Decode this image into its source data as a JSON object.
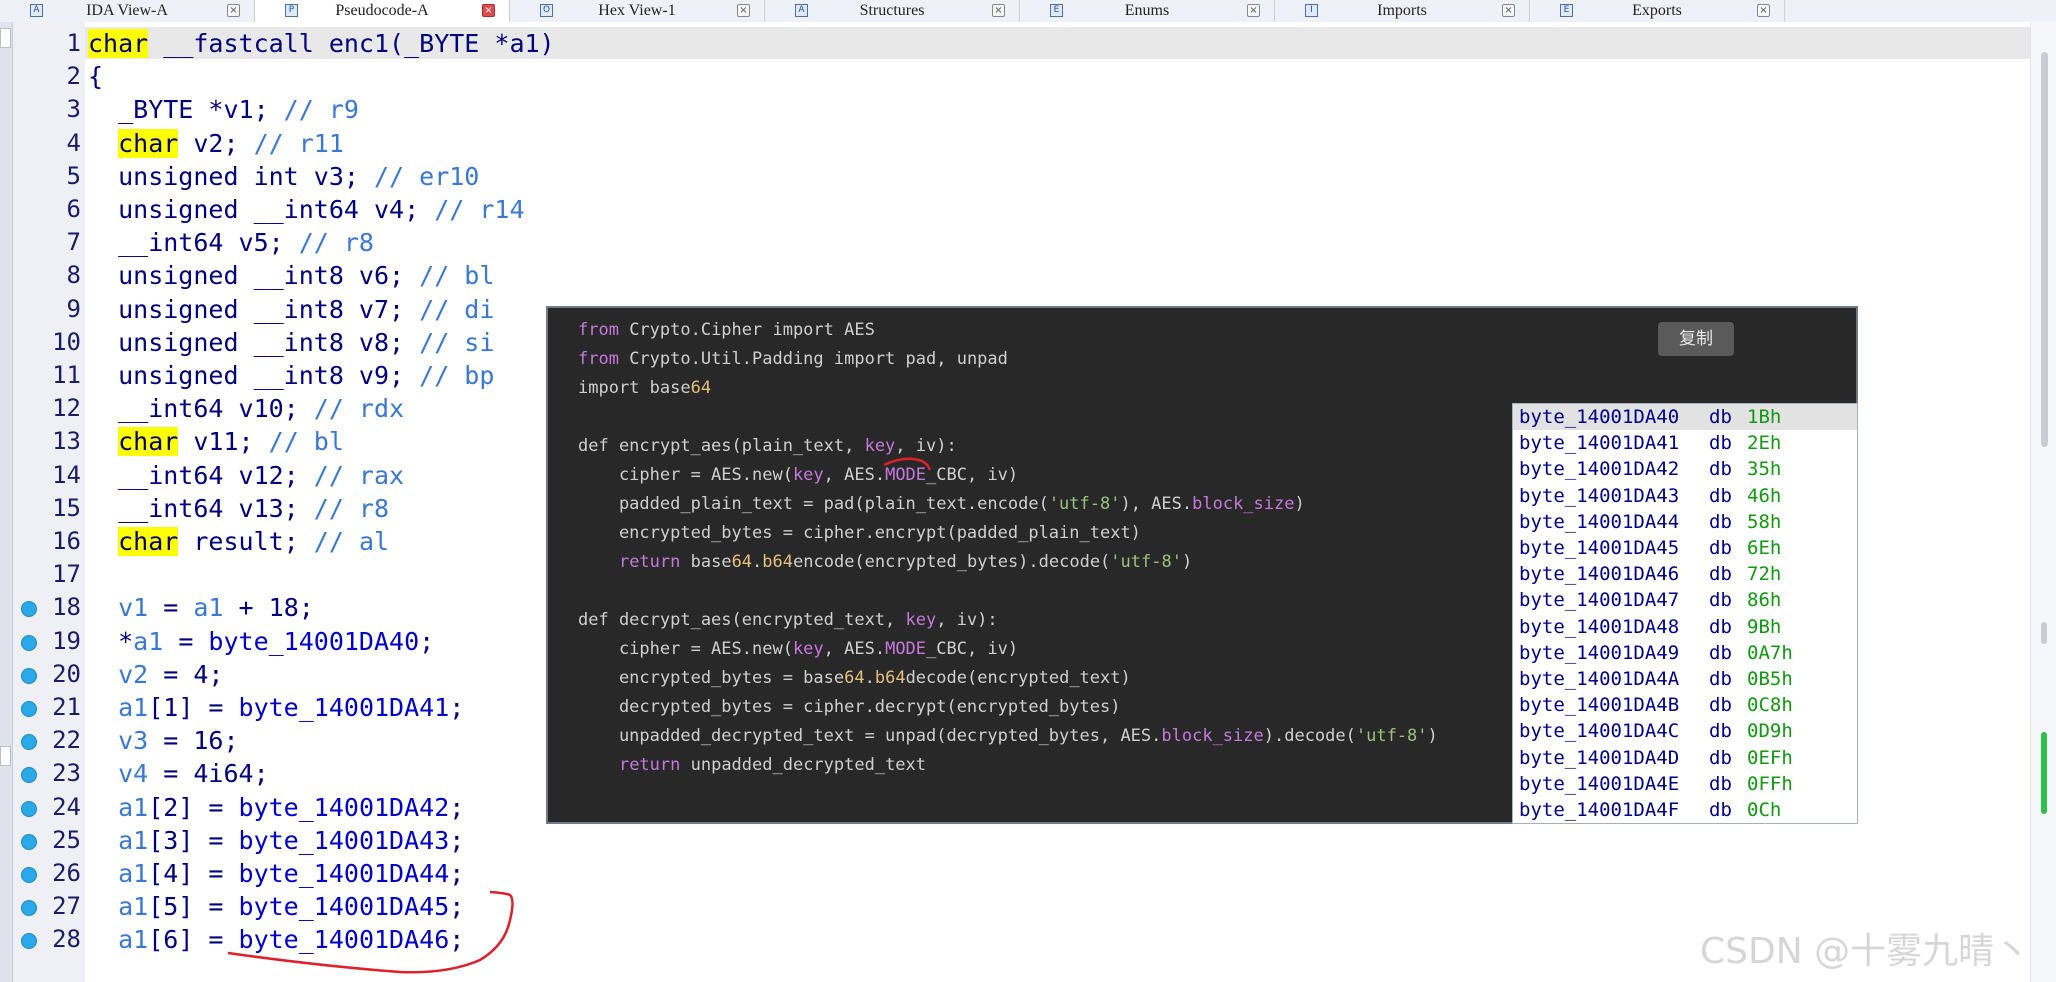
{
  "tabs": [
    {
      "label": "IDA View-A",
      "icon": "ida-view-icon",
      "active": false
    },
    {
      "label": "Pseudocode-A",
      "icon": "pseudocode-icon",
      "active": true
    },
    {
      "label": "Hex View-1",
      "icon": "hex-view-icon",
      "active": false
    },
    {
      "label": "Structures",
      "icon": "structures-icon",
      "active": false
    },
    {
      "label": "Enums",
      "icon": "enums-icon",
      "active": false
    },
    {
      "label": "Imports",
      "icon": "imports-icon",
      "active": false
    },
    {
      "label": "Exports",
      "icon": "exports-icon",
      "active": false
    }
  ],
  "tab_close_glyph": "×",
  "pseudocode": {
    "lines": [
      {
        "n": "1",
        "bp": false,
        "parts": [
          [
            "kw",
            "char"
          ],
          [
            "pl",
            " __fastcall enc1(_BYTE *a1)"
          ]
        ]
      },
      {
        "n": "2",
        "bp": false,
        "parts": [
          [
            "pl",
            "{"
          ]
        ]
      },
      {
        "n": "3",
        "bp": false,
        "parts": [
          [
            "pl",
            "  _BYTE *v1; "
          ],
          [
            "cmt",
            "// r9"
          ]
        ]
      },
      {
        "n": "4",
        "bp": false,
        "parts": [
          [
            "pl",
            "  "
          ],
          [
            "kw",
            "char"
          ],
          [
            "pl",
            " v2; "
          ],
          [
            "cmt",
            "// r11"
          ]
        ]
      },
      {
        "n": "5",
        "bp": false,
        "parts": [
          [
            "pl",
            "  unsigned int v3; "
          ],
          [
            "cmt",
            "// er10"
          ]
        ]
      },
      {
        "n": "6",
        "bp": false,
        "parts": [
          [
            "pl",
            "  unsigned __int64 v4; "
          ],
          [
            "cmt",
            "// r14"
          ]
        ]
      },
      {
        "n": "7",
        "bp": false,
        "parts": [
          [
            "pl",
            "  __int64 v5; "
          ],
          [
            "cmt",
            "// r8"
          ]
        ]
      },
      {
        "n": "8",
        "bp": false,
        "parts": [
          [
            "pl",
            "  unsigned __int8 v6; "
          ],
          [
            "cmt",
            "// bl"
          ]
        ]
      },
      {
        "n": "9",
        "bp": false,
        "parts": [
          [
            "pl",
            "  unsigned __int8 v7; "
          ],
          [
            "cmt",
            "// di"
          ]
        ]
      },
      {
        "n": "10",
        "bp": false,
        "parts": [
          [
            "pl",
            "  unsigned __int8 v8; "
          ],
          [
            "cmt",
            "// si"
          ]
        ]
      },
      {
        "n": "11",
        "bp": false,
        "parts": [
          [
            "pl",
            "  unsigned __int8 v9; "
          ],
          [
            "cmt",
            "// bp"
          ]
        ]
      },
      {
        "n": "12",
        "bp": false,
        "parts": [
          [
            "pl",
            "  __int64 v10; "
          ],
          [
            "cmt",
            "// rdx"
          ]
        ]
      },
      {
        "n": "13",
        "bp": false,
        "parts": [
          [
            "pl",
            "  "
          ],
          [
            "kw",
            "char"
          ],
          [
            "pl",
            " v11; "
          ],
          [
            "cmt",
            "// bl"
          ]
        ]
      },
      {
        "n": "14",
        "bp": false,
        "parts": [
          [
            "pl",
            "  __int64 v12; "
          ],
          [
            "cmt",
            "// rax"
          ]
        ]
      },
      {
        "n": "15",
        "bp": false,
        "parts": [
          [
            "pl",
            "  __int64 v13; "
          ],
          [
            "cmt",
            "// r8"
          ]
        ]
      },
      {
        "n": "16",
        "bp": false,
        "parts": [
          [
            "pl",
            "  "
          ],
          [
            "kw",
            "char"
          ],
          [
            "pl",
            " result; "
          ],
          [
            "cmt",
            "// al"
          ]
        ]
      },
      {
        "n": "17",
        "bp": false,
        "parts": []
      },
      {
        "n": "18",
        "bp": true,
        "parts": [
          [
            "pl",
            "  "
          ],
          [
            "var",
            "v1"
          ],
          [
            "pl",
            " = "
          ],
          [
            "var",
            "a1"
          ],
          [
            "pl",
            " + 18;"
          ]
        ]
      },
      {
        "n": "19",
        "bp": true,
        "parts": [
          [
            "pl",
            "  *"
          ],
          [
            "var",
            "a1"
          ],
          [
            "pl",
            " = "
          ],
          [
            "glob",
            "byte_14001DA40"
          ],
          [
            "pl",
            ";"
          ]
        ]
      },
      {
        "n": "20",
        "bp": true,
        "parts": [
          [
            "pl",
            "  "
          ],
          [
            "var",
            "v2"
          ],
          [
            "pl",
            " = 4;"
          ]
        ]
      },
      {
        "n": "21",
        "bp": true,
        "parts": [
          [
            "pl",
            "  "
          ],
          [
            "var",
            "a1"
          ],
          [
            "pl",
            "[1] = "
          ],
          [
            "glob",
            "byte_14001DA41"
          ],
          [
            "pl",
            ";"
          ]
        ]
      },
      {
        "n": "22",
        "bp": true,
        "parts": [
          [
            "pl",
            "  "
          ],
          [
            "var",
            "v3"
          ],
          [
            "pl",
            " = 16;"
          ]
        ]
      },
      {
        "n": "23",
        "bp": true,
        "parts": [
          [
            "pl",
            "  "
          ],
          [
            "var",
            "v4"
          ],
          [
            "pl",
            " = 4i64;"
          ]
        ]
      },
      {
        "n": "24",
        "bp": true,
        "parts": [
          [
            "pl",
            "  "
          ],
          [
            "var",
            "a1"
          ],
          [
            "pl",
            "[2] = "
          ],
          [
            "glob",
            "byte_14001DA42"
          ],
          [
            "pl",
            ";"
          ]
        ]
      },
      {
        "n": "25",
        "bp": true,
        "parts": [
          [
            "pl",
            "  "
          ],
          [
            "var",
            "a1"
          ],
          [
            "pl",
            "[3] = "
          ],
          [
            "glob",
            "byte_14001DA43"
          ],
          [
            "pl",
            ";"
          ]
        ]
      },
      {
        "n": "26",
        "bp": true,
        "parts": [
          [
            "pl",
            "  "
          ],
          [
            "var",
            "a1"
          ],
          [
            "pl",
            "[4] = "
          ],
          [
            "glob",
            "byte_14001DA44"
          ],
          [
            "pl",
            ";"
          ]
        ]
      },
      {
        "n": "27",
        "bp": true,
        "parts": [
          [
            "pl",
            "  "
          ],
          [
            "var",
            "a1"
          ],
          [
            "pl",
            "[5] = "
          ],
          [
            "glob",
            "byte_14001DA45"
          ],
          [
            "pl",
            ";"
          ]
        ]
      },
      {
        "n": "28",
        "bp": true,
        "parts": [
          [
            "pl",
            "  "
          ],
          [
            "var",
            "a1"
          ],
          [
            "pl",
            "[6] = "
          ],
          [
            "glob",
            "byte_14001DA46"
          ],
          [
            "pl",
            ";"
          ]
        ]
      }
    ]
  },
  "python_snippet": {
    "copy_label": "复制",
    "lines": [
      [
        [
          "kw",
          "from"
        ],
        [
          "pl",
          " Crypto.Cipher import AES"
        ]
      ],
      [
        [
          "kw",
          "from"
        ],
        [
          "pl",
          " Crypto.Util.Padding import pad, unpad"
        ]
      ],
      [
        [
          "pl",
          "import base"
        ],
        [
          "num",
          "64"
        ]
      ],
      [],
      [
        [
          "pl",
          "def encrypt_aes(plain_text, "
        ],
        [
          "kw",
          "key"
        ],
        [
          "pl",
          ", iv):"
        ]
      ],
      [
        [
          "pl",
          "    cipher = AES.new("
        ],
        [
          "kw",
          "key"
        ],
        [
          "pl",
          ", AES."
        ],
        [
          "kw",
          "MODE"
        ],
        [
          "pl",
          "_CBC, iv)"
        ]
      ],
      [
        [
          "pl",
          "    padded_plain_text = pad(plain_text.encode("
        ],
        [
          "str",
          "'utf-8'"
        ],
        [
          "pl",
          "), AES."
        ],
        [
          "kw",
          "block_size"
        ],
        [
          "pl",
          ")"
        ]
      ],
      [
        [
          "pl",
          "    encrypted_bytes = cipher.encrypt(padded_plain_text)"
        ]
      ],
      [
        [
          "pl",
          "    "
        ],
        [
          "kw",
          "return"
        ],
        [
          "pl",
          " base"
        ],
        [
          "num",
          "64"
        ],
        [
          "pl",
          "."
        ],
        [
          "num",
          "b64"
        ],
        [
          "pl",
          "encode(encrypted_bytes).decode("
        ],
        [
          "str",
          "'utf-8'"
        ],
        [
          "pl",
          ")"
        ]
      ],
      [],
      [
        [
          "pl",
          "def decrypt_aes(encrypted_text, "
        ],
        [
          "kw",
          "key"
        ],
        [
          "pl",
          ", iv):"
        ]
      ],
      [
        [
          "pl",
          "    cipher = AES.new("
        ],
        [
          "kw",
          "key"
        ],
        [
          "pl",
          ", AES."
        ],
        [
          "kw",
          "MODE"
        ],
        [
          "pl",
          "_CBC, iv)"
        ]
      ],
      [
        [
          "pl",
          "    encrypted_bytes = base"
        ],
        [
          "num",
          "64"
        ],
        [
          "pl",
          "."
        ],
        [
          "num",
          "b64"
        ],
        [
          "pl",
          "decode(encrypted_text)"
        ]
      ],
      [
        [
          "pl",
          "    decrypted_bytes = cipher.decrypt(encrypted_bytes)"
        ]
      ],
      [
        [
          "pl",
          "    unpadded_decrypted_text = unpad(decrypted_bytes, AES."
        ],
        [
          "kw",
          "block_size"
        ],
        [
          "pl",
          ").decode("
        ],
        [
          "str",
          "'utf-8'"
        ],
        [
          "pl",
          ")"
        ]
      ],
      [
        [
          "pl",
          "    "
        ],
        [
          "kw",
          "return"
        ],
        [
          "pl",
          " unpadded_decrypted_text"
        ]
      ]
    ]
  },
  "hex_list": {
    "selected_index": 0,
    "rows": [
      {
        "name": "byte_14001DA40",
        "db": "db",
        "val": "1Bh"
      },
      {
        "name": "byte_14001DA41",
        "db": "db",
        "val": "2Eh"
      },
      {
        "name": "byte_14001DA42",
        "db": "db",
        "val": "35h"
      },
      {
        "name": "byte_14001DA43",
        "db": "db",
        "val": "46h"
      },
      {
        "name": "byte_14001DA44",
        "db": "db",
        "val": "58h"
      },
      {
        "name": "byte_14001DA45",
        "db": "db",
        "val": "6Eh"
      },
      {
        "name": "byte_14001DA46",
        "db": "db",
        "val": "72h"
      },
      {
        "name": "byte_14001DA47",
        "db": "db",
        "val": "86h"
      },
      {
        "name": "byte_14001DA48",
        "db": "db",
        "val": "9Bh"
      },
      {
        "name": "byte_14001DA49",
        "db": "db",
        "val": "0A7h"
      },
      {
        "name": "byte_14001DA4A",
        "db": "db",
        "val": "0B5h"
      },
      {
        "name": "byte_14001DA4B",
        "db": "db",
        "val": "0C8h"
      },
      {
        "name": "byte_14001DA4C",
        "db": "db",
        "val": "0D9h"
      },
      {
        "name": "byte_14001DA4D",
        "db": "db",
        "val": "0EFh"
      },
      {
        "name": "byte_14001DA4E",
        "db": "db",
        "val": "0FFh"
      },
      {
        "name": "byte_14001DA4F",
        "db": "db",
        "val": "0Ch"
      }
    ]
  },
  "watermark": "CSDN @十雾九晴丶",
  "colors": {
    "keyword_highlight": "#ffff00",
    "breakpoint": "#2aa8e8",
    "annotation_red": "#e0202a",
    "hex_value": "#119911"
  }
}
